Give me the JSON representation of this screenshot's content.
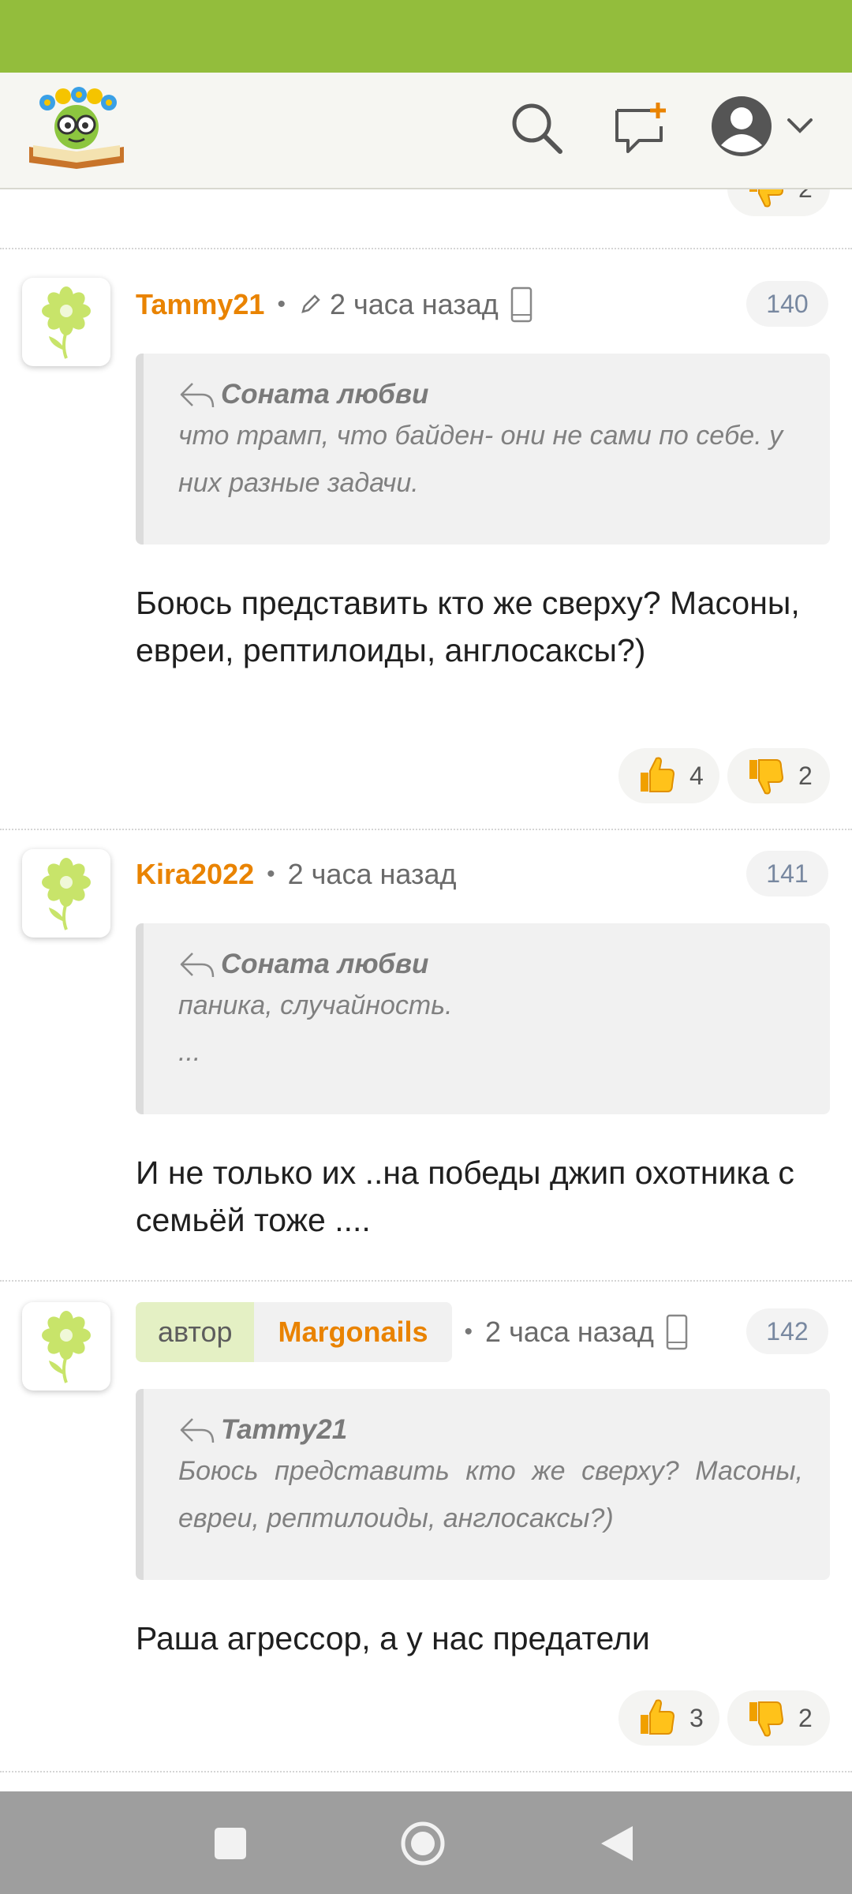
{
  "header": {
    "logo_alt": "site-logo"
  },
  "top_vote": {
    "dislikes": "2"
  },
  "comments": [
    {
      "username": "Tammy21",
      "time": "2 часа назад",
      "number": "140",
      "quote_author": "Соната любви",
      "quote_text": "что трамп, что байден- они не сами по себе. у них разные задачи.",
      "body": "Боюсь представить кто же сверху? Масоны, евреи, рептилоиды, англосаксы?)",
      "likes": "4",
      "dislikes": "2"
    },
    {
      "username": "Kira2022",
      "time": "2 часа назад",
      "number": "141",
      "quote_author": "Соната любви",
      "quote_text_1": "паника, случайность.",
      "quote_text_2": "...",
      "body": "И не только их ..на победы джип охотника с семьёй тоже ...."
    },
    {
      "author_tag": "автор",
      "username": "Margonails",
      "time": "2 часа назад",
      "number": "142",
      "quote_author": "Tammy21",
      "quote_text": "Боюсь представить кто же сверху? Масоны, евреи, рептилоиды, англосаксы?)",
      "body": "Раша агрессор, а у нас предатели",
      "likes": "3",
      "dislikes": "2"
    }
  ]
}
